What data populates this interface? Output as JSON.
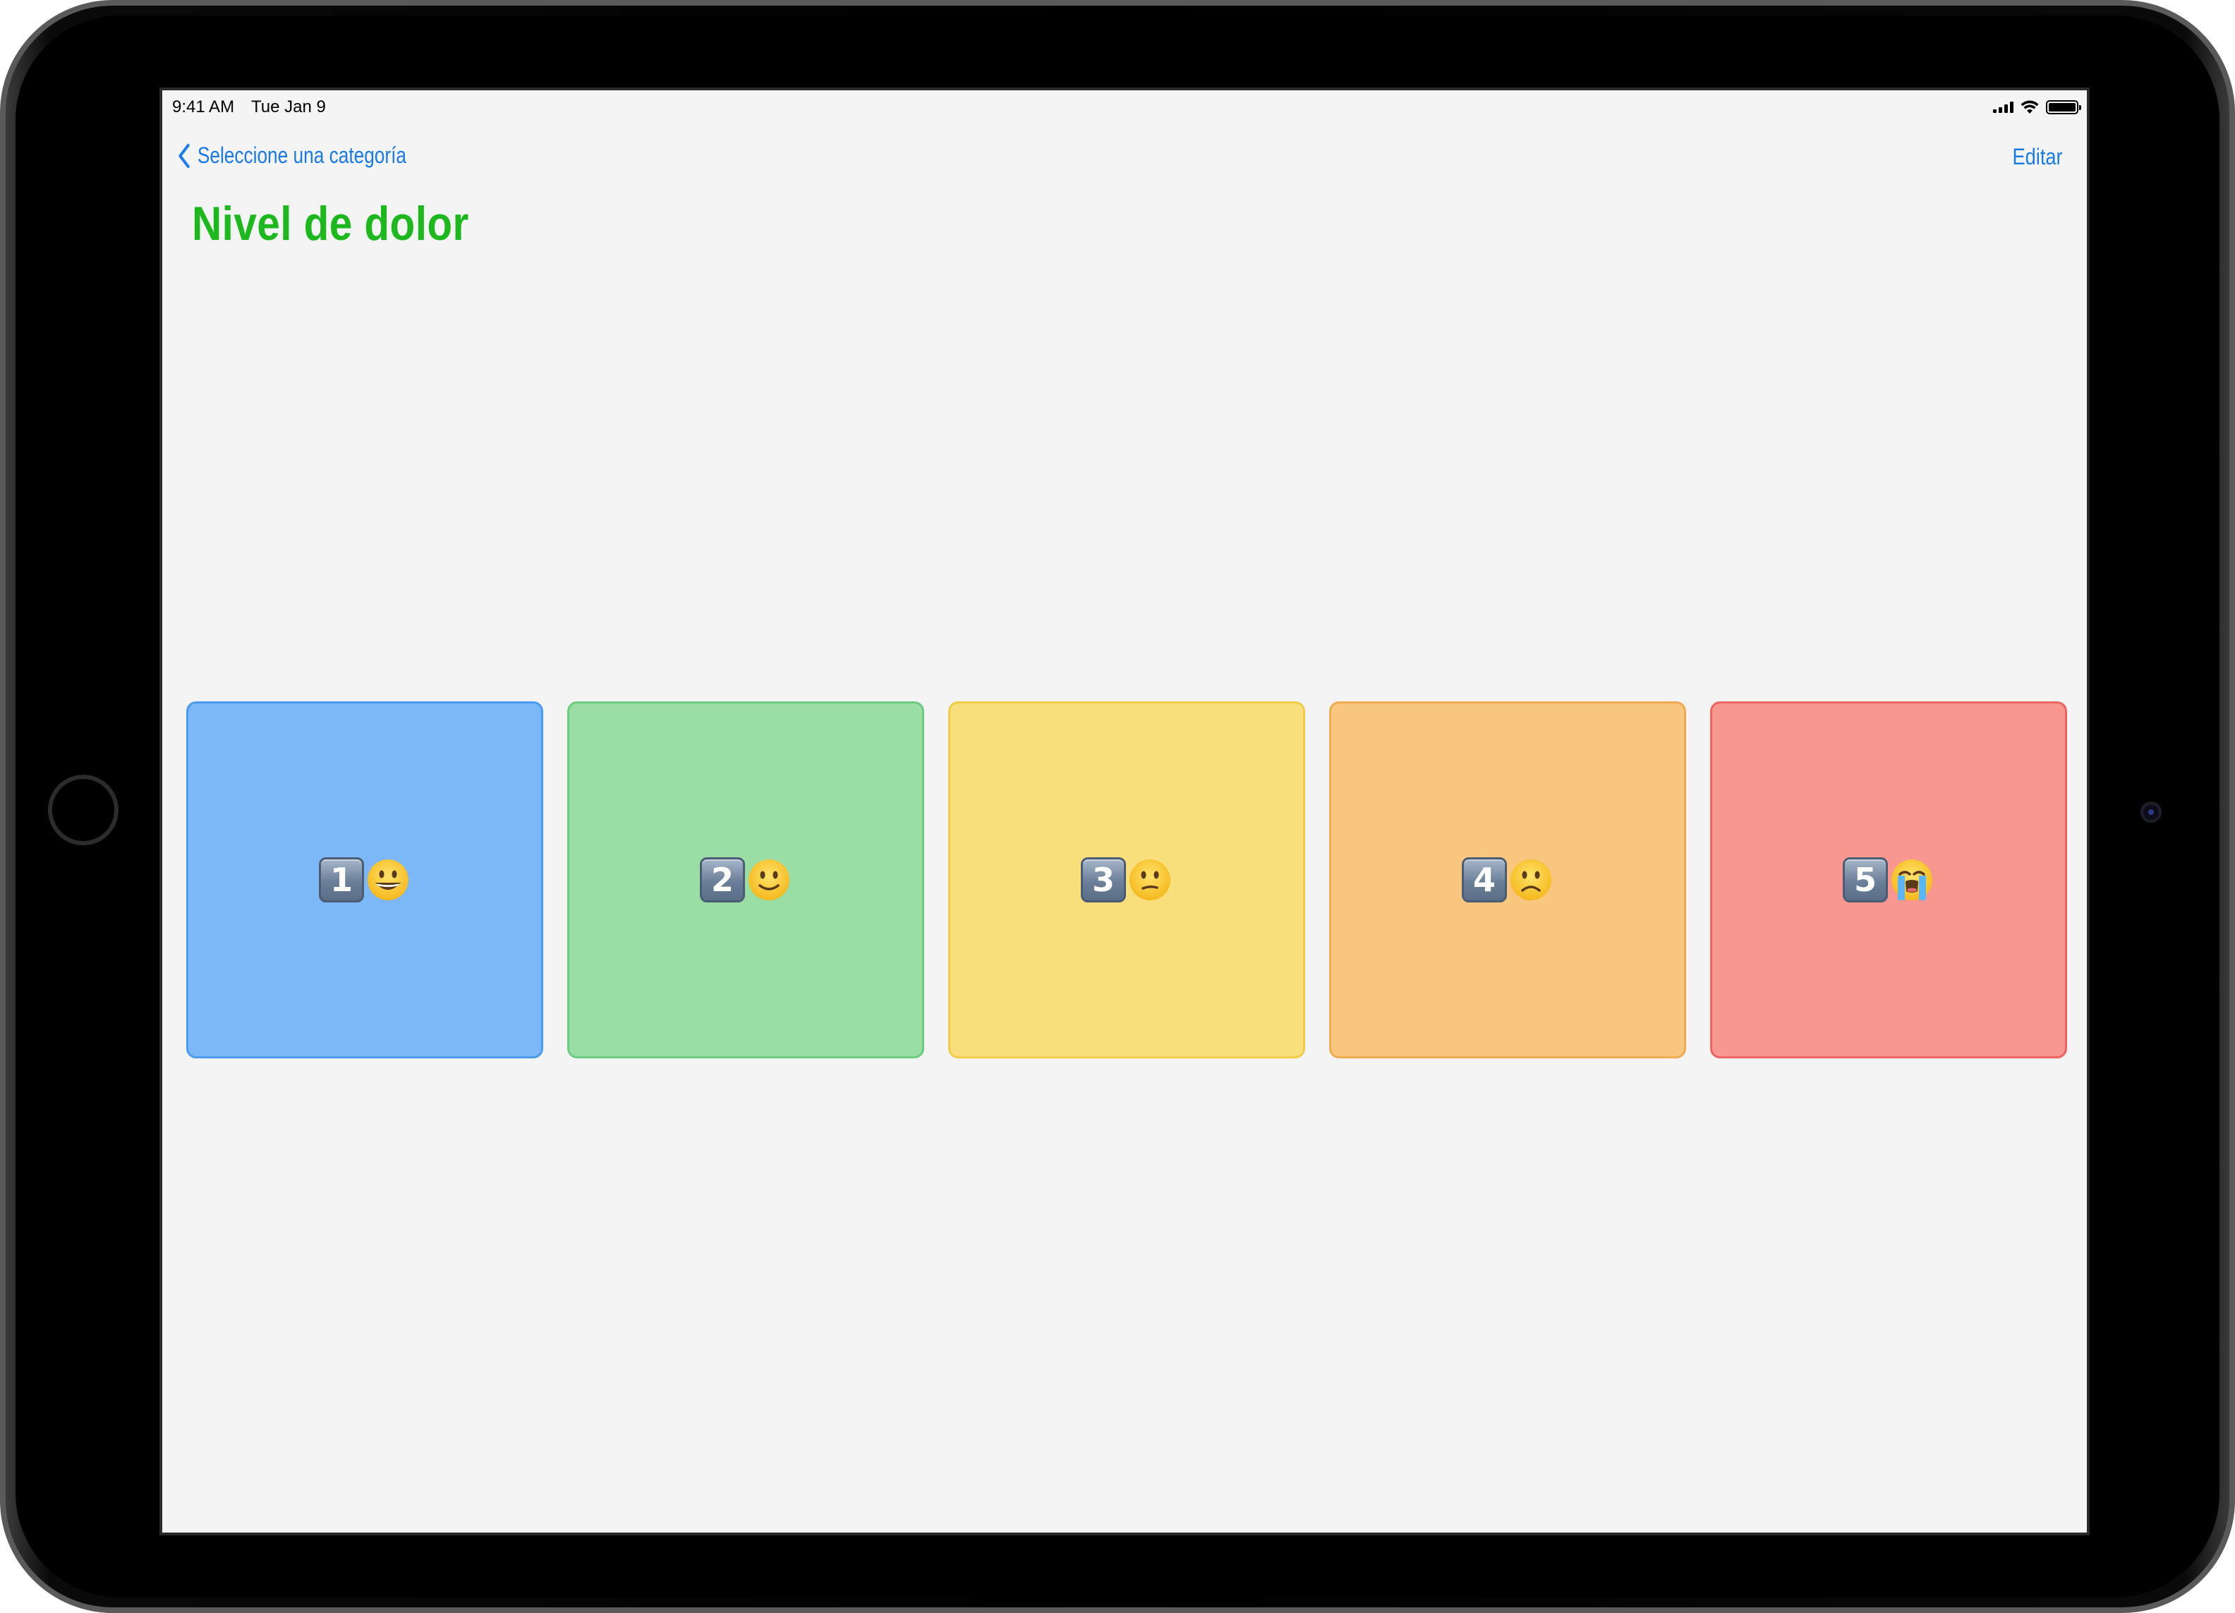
{
  "status_bar": {
    "time": "9:41 AM",
    "date": "Tue Jan 9"
  },
  "nav": {
    "back_label": "Seleccione una categoría",
    "edit_label": "Editar"
  },
  "page": {
    "title": "Nivel de dolor"
  },
  "colors": {
    "accent": "#1a7ae6",
    "title": "#1db81d",
    "background": "#f4f4f4"
  },
  "tiles": [
    {
      "number": "1",
      "face": "grinning-face-icon",
      "fill": "#7cb8f8",
      "border": "#4a9bf0"
    },
    {
      "number": "2",
      "face": "slightly-smiling-face-icon",
      "fill": "#9ade a6",
      "border": "#6dcc81"
    },
    {
      "number": "3",
      "face": "confused-face-icon",
      "fill": "#f8df7c",
      "border": "#f0cc4a"
    },
    {
      "number": "4",
      "face": "frowning-face-icon",
      "fill": "#f8c67e",
      "border": "#f0aa52"
    },
    {
      "number": "5",
      "face": "loudly-crying-face-icon",
      "fill": "#f89690",
      "border": "#ee6460"
    }
  ]
}
